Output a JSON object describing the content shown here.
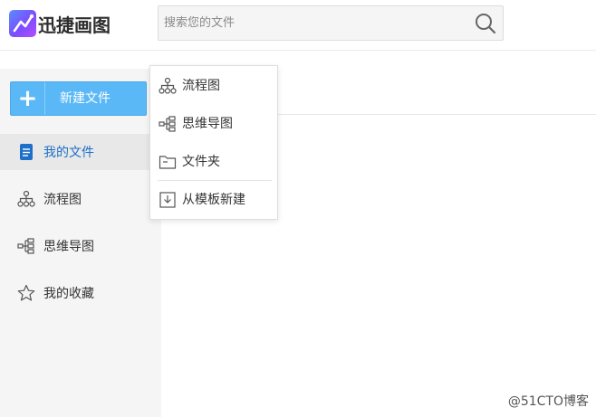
{
  "header": {
    "app_name": "迅捷画图",
    "logo_icon": "chart-line-logo-icon",
    "search": {
      "placeholder": "搜索您的文件",
      "icon": "search-icon"
    }
  },
  "sidebar": {
    "new_button": {
      "label": "新建文件",
      "icon": "plus-icon",
      "color": "#5bb8f7"
    },
    "items": [
      {
        "label": "我的文件",
        "icon": "document-icon",
        "active": true
      },
      {
        "label": "流程图",
        "icon": "flowchart-icon",
        "active": false
      },
      {
        "label": "思维导图",
        "icon": "mindmap-icon",
        "active": false
      },
      {
        "label": "我的收藏",
        "icon": "star-icon",
        "active": false
      }
    ]
  },
  "dropdown": {
    "items": [
      {
        "label": "流程图",
        "icon": "flowchart-icon"
      },
      {
        "label": "思维导图",
        "icon": "mindmap-icon"
      },
      {
        "label": "文件夹",
        "icon": "folder-icon"
      },
      {
        "label": "从模板新建",
        "icon": "template-download-icon"
      }
    ]
  },
  "watermark": "@51CTO博客",
  "colors": {
    "accent": "#5bb8f7",
    "active_text": "#1d6fc9",
    "sidebar_bg": "#f5f5f5"
  }
}
